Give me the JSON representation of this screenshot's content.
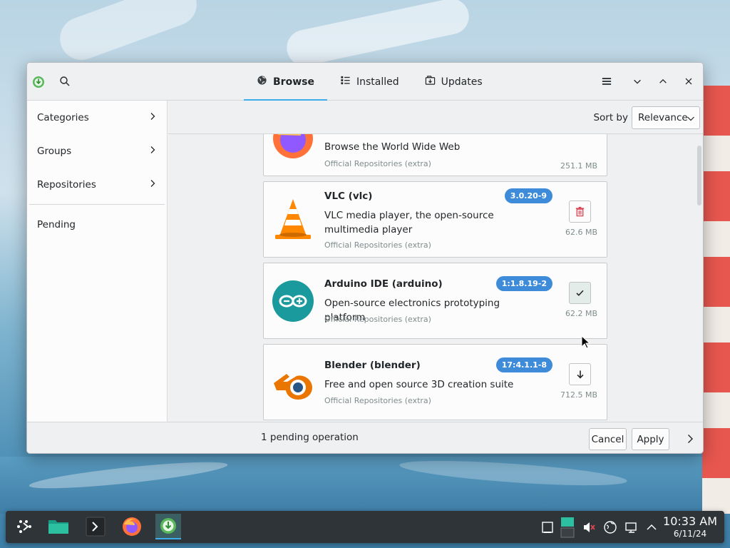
{
  "titlebar": {
    "tabs": [
      {
        "label": "Browse",
        "icon": "globe-icon",
        "active": true
      },
      {
        "label": "Installed",
        "icon": "list-icon",
        "active": false
      },
      {
        "label": "Updates",
        "icon": "updates-icon",
        "active": false
      }
    ]
  },
  "sidebar": {
    "items": [
      {
        "label": "Categories"
      },
      {
        "label": "Groups"
      },
      {
        "label": "Repositories"
      },
      {
        "label": "Pending"
      }
    ]
  },
  "sort": {
    "label": "Sort by",
    "value": "Relevance"
  },
  "packages": [
    {
      "name": "",
      "description": "Browse the World Wide Web",
      "repo": "Official Repositories (extra)",
      "version": "",
      "size": "251.1 MB",
      "action": "remove"
    },
    {
      "name": "VLC (vlc)",
      "description": "VLC media player, the open-source multimedia player",
      "repo": "Official Repositories (extra)",
      "version": "3.0.20-9",
      "size": "62.6 MB",
      "action": "remove"
    },
    {
      "name": "Arduino IDE (arduino)",
      "description": "Open-source electronics prototyping platform",
      "repo": "Official Repositories (extra)",
      "version": "1:1.8.19-2",
      "size": "62.2 MB",
      "action": "installed"
    },
    {
      "name": "Blender (blender)",
      "description": "Free and open source 3D creation suite",
      "repo": "Official Repositories (extra)",
      "version": "17:4.1.1-8",
      "size": "712.5 MB",
      "action": "install"
    }
  ],
  "footer": {
    "pending": "1 pending operation",
    "cancel": "Cancel",
    "apply": "Apply"
  },
  "clock": {
    "time": "10:33 AM",
    "date": "6/11/24"
  },
  "colors": {
    "accent": "#3daee9",
    "version_badge": "#3d8bd9",
    "remove_red": "#da4453"
  }
}
